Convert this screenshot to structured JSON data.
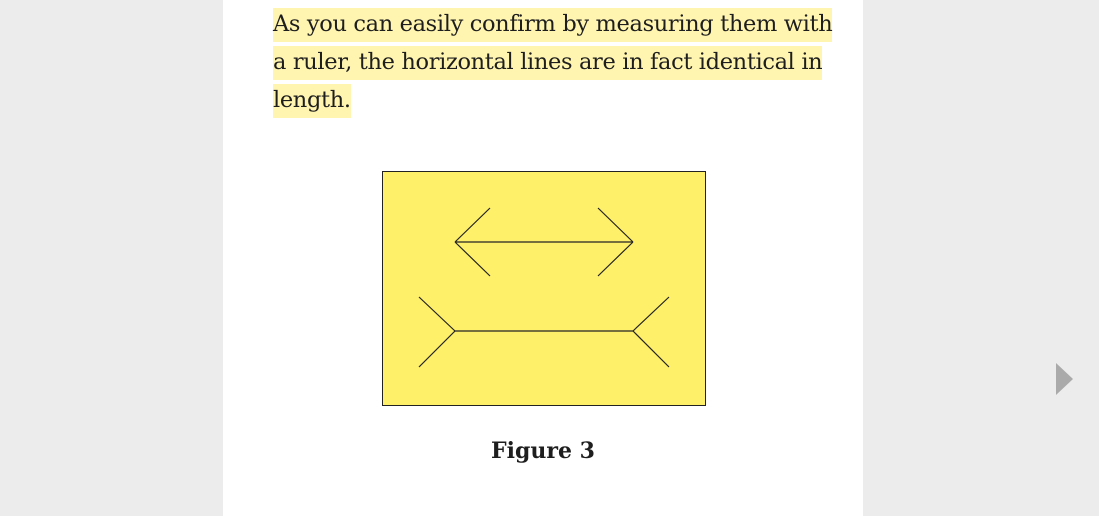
{
  "reader": {
    "passage_text": "As you can easily confirm by measuring them with a ruler, the horizontal lines are in fact identical in length.",
    "figure_caption": "Figure 3"
  },
  "figure": {
    "background_color": "#fff06a",
    "line_color": "#222222"
  },
  "colors": {
    "highlight": "#fff5b0",
    "page_background": "#ffffff",
    "viewer_background": "#ececec",
    "nav_arrow": "#aaaaaa"
  },
  "navigation": {
    "next_icon": "triangle-right-icon"
  }
}
